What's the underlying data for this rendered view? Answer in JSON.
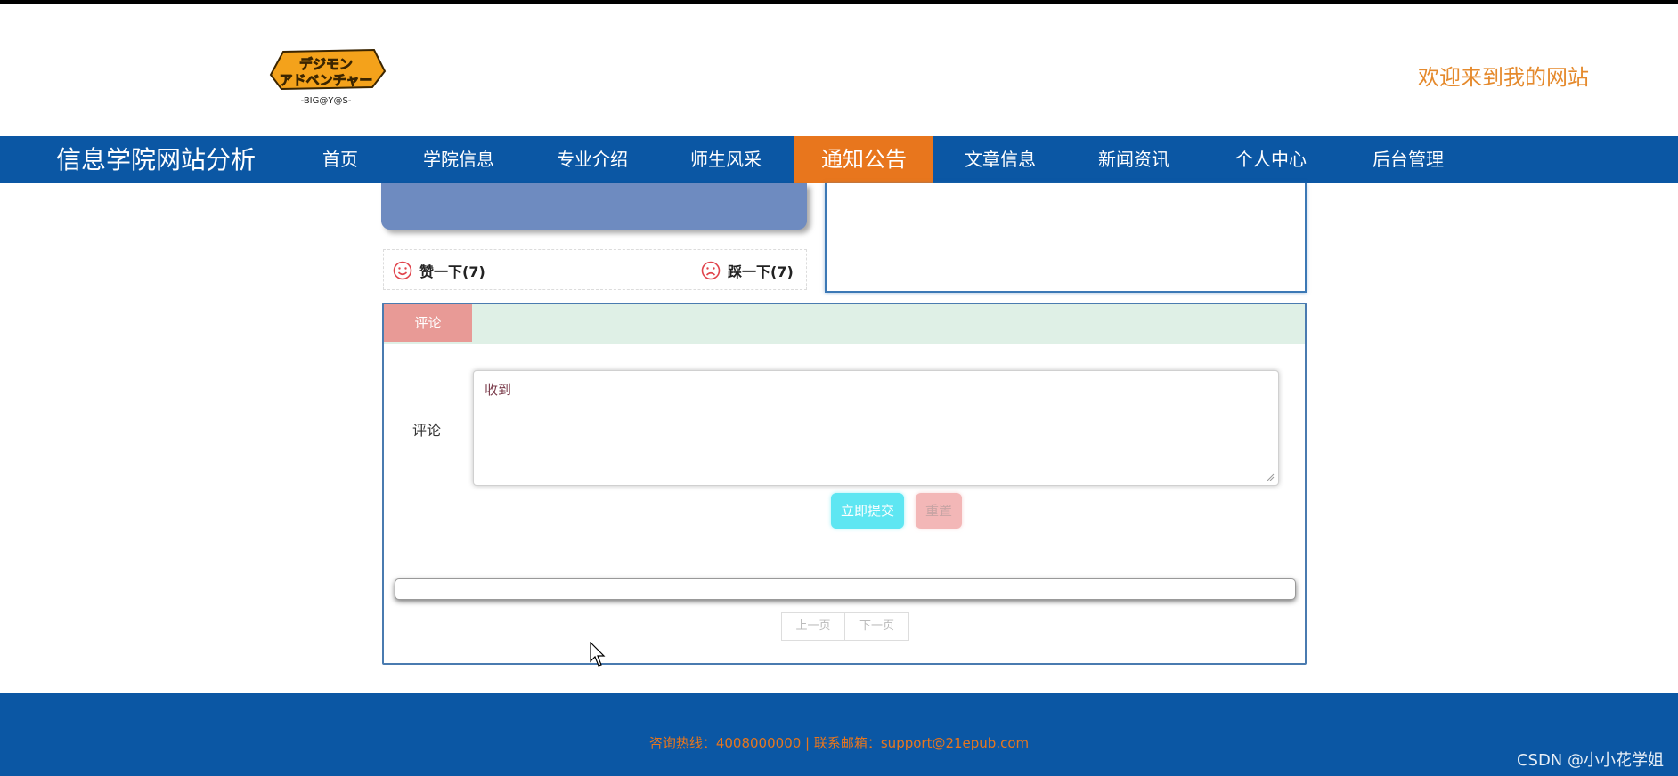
{
  "header": {
    "logo_text_top": "デジモン",
    "logo_text_mid": "アドベンチャー",
    "logo_text_sub": "-BIG@Y@S-",
    "welcome": "欢迎来到我的网站"
  },
  "nav": {
    "site_title": "信息学院网站分析",
    "items": [
      {
        "label": "首页"
      },
      {
        "label": "学院信息"
      },
      {
        "label": "专业介绍"
      },
      {
        "label": "师生风采"
      },
      {
        "label": "通知公告",
        "active": true
      },
      {
        "label": "文章信息"
      },
      {
        "label": "新闻资讯"
      },
      {
        "label": "个人中心"
      },
      {
        "label": "后台管理"
      }
    ]
  },
  "votes": {
    "like": "赞一下(7)",
    "dislike": "踩一下(7)"
  },
  "comment": {
    "tab_label": "评论",
    "field_label": "评论",
    "textarea_value": "收到",
    "submit_label": "立即提交",
    "reset_label": "重置"
  },
  "pager": {
    "prev": "上一页",
    "next": "下一页"
  },
  "footer": {
    "text": "咨询热线：4008000000 | 联系邮箱：support@21epub.com",
    "watermark": "CSDN @小小花学姐"
  },
  "colors": {
    "nav_bg": "#0b57a4",
    "nav_active": "#e8761d",
    "welcome": "#e58a2d",
    "submit": "#5ee6f2",
    "reset": "#f3b7b7",
    "tab": "#e89a96",
    "tabbar": "#dff0e6"
  }
}
